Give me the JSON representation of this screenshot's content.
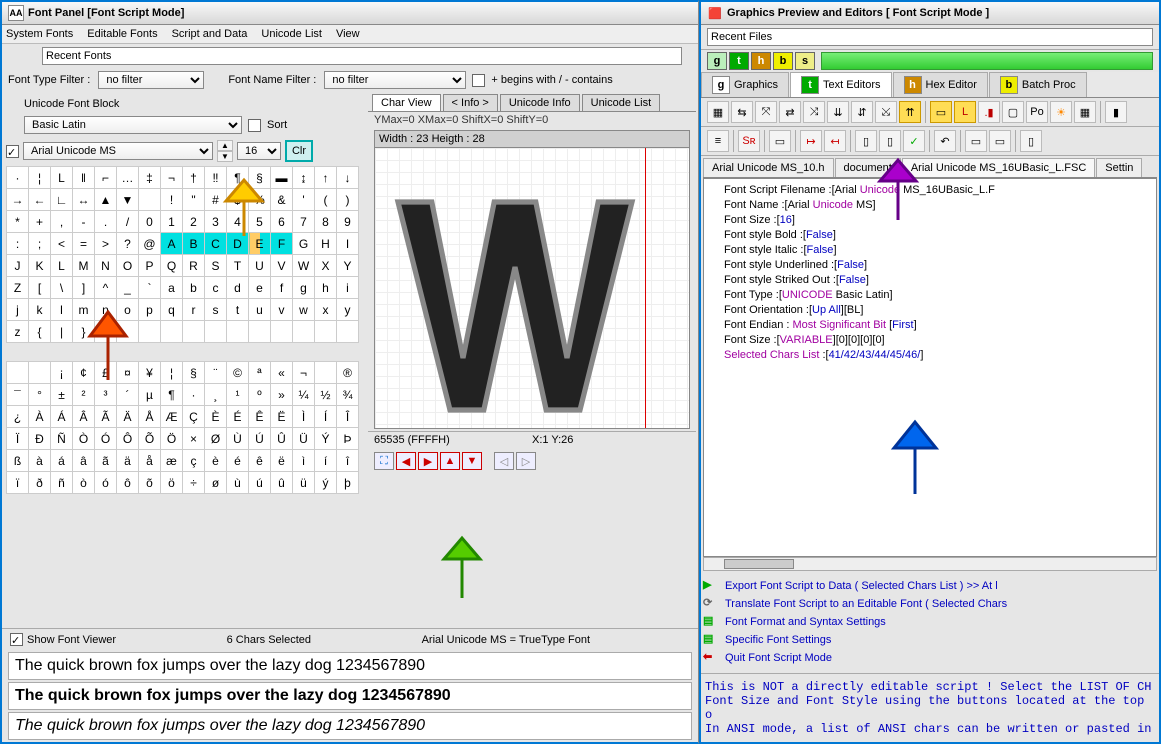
{
  "left_window_title": "Font Panel [Font Script Mode]",
  "menubar": [
    "System Fonts",
    "Editable Fonts",
    "Script and Data",
    "Unicode List",
    "View"
  ],
  "recent_fonts_label": "Recent Fonts",
  "font_type_filter_label": "Font Type Filter :",
  "font_type_filter_value": "no filter",
  "font_name_filter_label": "Font Name Filter :",
  "font_name_filter_value": "no filter",
  "begins_contains_label": "+ begins with / - contains",
  "unicode_block_label": "Unicode Font Block",
  "unicode_block_value": "Basic Latin",
  "sort_label": "Sort",
  "font_dropdown": "Arial Unicode MS",
  "font_size": "16",
  "clr_label": "Clr",
  "char_grid_rows": [
    [
      "·",
      "¦",
      "L",
      "‖",
      "⌐",
      "…",
      "‡",
      "¬",
      "†",
      "‼",
      "¶",
      "§",
      "▬",
      "↨",
      "↑",
      "↓"
    ],
    [
      "→",
      "←",
      "∟",
      "↔",
      "▲",
      "▼",
      "",
      "!",
      "\"",
      "#",
      "$",
      "%",
      "&",
      "'",
      "(",
      ")"
    ],
    [
      "*",
      "+",
      ",",
      "-",
      ".",
      "/",
      "0",
      "1",
      "2",
      "3",
      "4",
      "5",
      "6",
      "7",
      "8",
      "9"
    ],
    [
      ":",
      ";",
      "<",
      "=",
      ">",
      "?",
      "@",
      "A",
      "B",
      "C",
      "D",
      "E",
      "F",
      "G",
      "H",
      "I"
    ],
    [
      "J",
      "K",
      "L",
      "M",
      "N",
      "O",
      "P",
      "Q",
      "R",
      "S",
      "T",
      "U",
      "V",
      "W",
      "X",
      "Y"
    ],
    [
      "Z",
      "[",
      "\\",
      "]",
      "^",
      "_",
      "`",
      "a",
      "b",
      "c",
      "d",
      "e",
      "f",
      "g",
      "h",
      "i"
    ],
    [
      "j",
      "k",
      "l",
      "m",
      "n",
      "o",
      "p",
      "q",
      "r",
      "s",
      "t",
      "u",
      "v",
      "w",
      "x",
      "y"
    ],
    [
      "z",
      "{",
      "|",
      "}",
      "~",
      "",
      "",
      "",
      "",
      "",
      "",
      "",
      "",
      "",
      "",
      ""
    ]
  ],
  "ext_grid_rows": [
    [
      "",
      "",
      "¡",
      "¢",
      "£",
      "¤",
      "¥",
      "¦",
      "§",
      "¨",
      "©",
      "ª",
      "«",
      "¬",
      "­",
      "®"
    ],
    [
      "¯",
      "°",
      "±",
      "²",
      "³",
      "´",
      "µ",
      "¶",
      "·",
      "¸",
      "¹",
      "º",
      "»",
      "¼",
      "½",
      "¾"
    ],
    [
      "¿",
      "À",
      "Á",
      "Â",
      "Ã",
      "Ä",
      "Å",
      "Æ",
      "Ç",
      "È",
      "É",
      "Ê",
      "Ë",
      "Ì",
      "Í",
      "Î"
    ],
    [
      "Ï",
      "Ð",
      "Ñ",
      "Ò",
      "Ó",
      "Ô",
      "Õ",
      "Ö",
      "×",
      "Ø",
      "Ù",
      "Ú",
      "Û",
      "Ü",
      "Ý",
      "Þ"
    ],
    [
      "ß",
      "à",
      "á",
      "â",
      "ã",
      "ä",
      "å",
      "æ",
      "ç",
      "è",
      "é",
      "ê",
      "ë",
      "ì",
      "í",
      "î"
    ],
    [
      "ï",
      "ð",
      "ñ",
      "ò",
      "ó",
      "ô",
      "õ",
      "ö",
      "÷",
      "ø",
      "ù",
      "ú",
      "û",
      "ü",
      "ý",
      "þ"
    ]
  ],
  "char_tabs": [
    "Char View",
    "< Info >",
    "Unicode Info",
    "Unicode List"
  ],
  "metrics_line": "YMax=0  XMax=0  ShiftX=0  ShiftY=0",
  "bitmap_head": "Width : 23  Heigth : 28",
  "codepoint": "65535  (FFFFH)",
  "cursor_pos": "X:1 Y:26",
  "show_font_viewer": "Show Font Viewer",
  "chars_selected": "6 Chars Selected",
  "font_equals": "Arial Unicode MS = TrueType Font",
  "preview_text": "The quick brown fox jumps over the lazy dog 1234567890",
  "right_window_title": "Graphics Preview and Editors [ Font Script Mode ]",
  "recent_files_label": "Recent Files",
  "sq_labels": [
    "g",
    "t",
    "h",
    "b",
    "s"
  ],
  "right_tabs": [
    {
      "badge": "g",
      "label": "Graphics"
    },
    {
      "badge": "t",
      "label": "Text Editors"
    },
    {
      "badge": "h",
      "label": "Hex Editor"
    },
    {
      "badge": "b",
      "label": "Batch Proc"
    }
  ],
  "doc_tabs": [
    "Arial Unicode MS_10.h",
    "document",
    "Arial Unicode MS_16UBasic_L.FSC",
    "Settin"
  ],
  "doc_tabs_active": 2,
  "script_lines": [
    {
      "t": "Font Script Filename :[Arial ",
      "kw": "Unicode",
      "t2": " MS_16UBasic_L.F"
    },
    {
      "t": "Font Name :[Arial ",
      "kw": "Unicode",
      "t2": " MS]"
    },
    {
      "t": "Font Size :[",
      "val": "16",
      "t2": "]"
    },
    {
      "t": "Font style Bold :[",
      "val": "False",
      "t2": "]"
    },
    {
      "t": "Font style Italic :[",
      "val": "False",
      "t2": "]"
    },
    {
      "t": "Font style Underlined :[",
      "val": "False",
      "t2": "]"
    },
    {
      "t": "Font style Striked Out :[",
      "val": "False",
      "t2": "]"
    },
    {
      "t": "Font Type :[",
      "kw": "UNICODE",
      "t2": " Basic Latin]"
    },
    {
      "t": "Font Orientation :[",
      "val": "Up All",
      "t2": "][BL]"
    },
    {
      "t": "Font Endian : ",
      "kw": "Most Significant Bit",
      "t2": " [",
      "val": "First",
      "t3": "]"
    },
    {
      "t": "Font Size :[",
      "kw": "VARIABLE",
      "t2": "][0][0][0][0]"
    },
    {
      "kw": "Selected Chars List",
      "t": " :[",
      "val": "41/42/43/44/45/46/",
      "t2": "]"
    }
  ],
  "links": [
    {
      "icon": "export",
      "color": "#0a0",
      "text": "Export Font Script to Data  ( Selected Chars List ) >> At l"
    },
    {
      "icon": "translate",
      "color": "#666",
      "text": "Translate Font Script to an Editable Font ( Selected Chars "
    },
    {
      "icon": "format",
      "color": "#0a0",
      "text": "Font Format and Syntax Settings"
    },
    {
      "icon": "settings",
      "color": "#0a0",
      "text": "Specific Font Settings"
    },
    {
      "icon": "quit",
      "color": "#c00",
      "text": "Quit Font Script Mode"
    }
  ],
  "notice": " This is NOT a directly editable script ! Select the LIST OF CH\nFont Size and Font Style using the buttons located at the top o\n In ANSI mode, a list of ANSI chars can be written or pasted in"
}
